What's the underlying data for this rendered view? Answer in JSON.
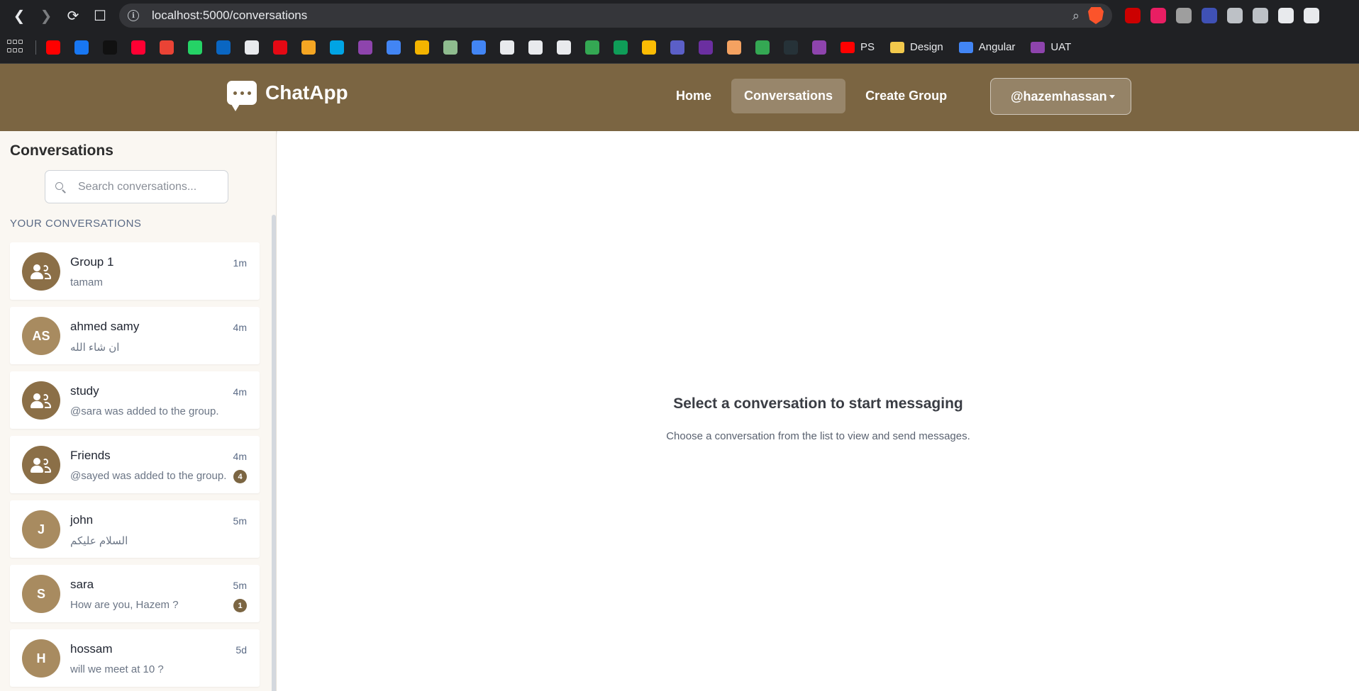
{
  "browser": {
    "url": "localhost:5000/conversations",
    "bookmarks_named": [
      {
        "label": "PS",
        "color": "#ff0000"
      },
      {
        "label": "Design",
        "color": "#f2c94c"
      },
      {
        "label": "Angular",
        "color": "#4285f4"
      },
      {
        "label": "UAT",
        "color": "#8e44ad"
      }
    ],
    "bookmark_colors": [
      "#ff0000",
      "#1877f2",
      "#111111",
      "#ff0033",
      "#ea4335",
      "#25d366",
      "#0a66c2",
      "#e8eaed",
      "#e50914",
      "#f5a623",
      "#00a4e4",
      "#8e44ad",
      "#4285f4",
      "#f4b400",
      "#8fbc8f",
      "#4285f4",
      "#e8eaed",
      "#e8eaed",
      "#e8eaed",
      "#34a853",
      "#0f9d58",
      "#fbbc04",
      "#5b5fc7",
      "#6b2fa0",
      "#f4a261",
      "#34a853",
      "#263238",
      "#8e44ad"
    ],
    "extension_colors": [
      "#cc0000",
      "#e91e63",
      "#9e9e9e",
      "#3f51b5",
      "#bdc1c6",
      "#bdc1c6",
      "#e8eaed",
      "#e8eaed"
    ]
  },
  "app": {
    "brand": "ChatApp",
    "nav": {
      "home": "Home",
      "conversations": "Conversations",
      "create_group": "Create Group"
    },
    "user": "@hazemhassan",
    "accent": "#7b6542"
  },
  "sidebar": {
    "title": "Conversations",
    "search_placeholder": "Search conversations...",
    "section_label": "YOUR CONVERSATIONS",
    "conversations": [
      {
        "name": "Group 1",
        "type": "group",
        "time": "1m",
        "last": "tamam",
        "unread": null
      },
      {
        "name": "ahmed samy",
        "type": "user",
        "initials": "AS",
        "time": "4m",
        "last": "ان شاء الله",
        "unread": null
      },
      {
        "name": "study",
        "type": "group",
        "time": "4m",
        "last": "@sara was added to the group.",
        "unread": null
      },
      {
        "name": "Friends",
        "type": "group",
        "time": "4m",
        "last": "@sayed was added to the group.",
        "unread": "4"
      },
      {
        "name": "john",
        "type": "user",
        "initials": "J",
        "time": "5m",
        "last": "السلام عليكم",
        "unread": null
      },
      {
        "name": "sara",
        "type": "user",
        "initials": "S",
        "time": "5m",
        "last": "How are you, Hazem ?",
        "unread": "1"
      },
      {
        "name": "hossam",
        "type": "user",
        "initials": "H",
        "time": "5d",
        "last": "will we meet at 10 ?",
        "unread": null
      }
    ]
  },
  "empty_state": {
    "title": "Select a conversation to start messaging",
    "subtitle": "Choose a conversation from the list to view and send messages."
  }
}
